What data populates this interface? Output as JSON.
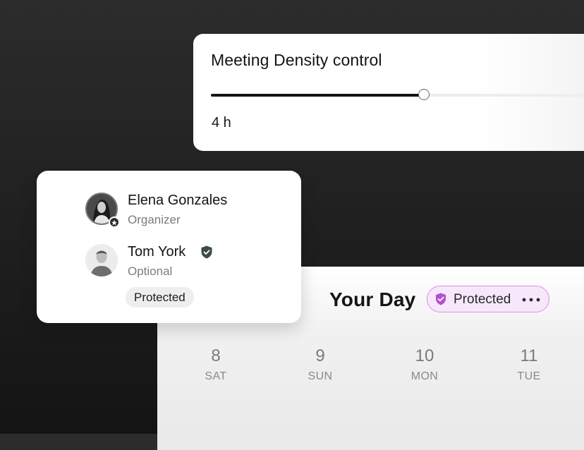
{
  "density": {
    "title": "Meeting Density control",
    "value_label": "4 h",
    "slider_level_percent": 54
  },
  "attendees": [
    {
      "name": "Elena Gonzales",
      "role": "Organizer",
      "badge_icon": "star-icon"
    },
    {
      "name": "Tom York",
      "role": "Optional",
      "badge_icon": "shield-check-icon"
    }
  ],
  "attendee_tag": "Protected",
  "calendar": {
    "title": "Your Day",
    "status_label": "Protected",
    "status_color": "#b24fd1",
    "days": [
      {
        "num": "8",
        "name": "SAT"
      },
      {
        "num": "9",
        "name": "SUN"
      },
      {
        "num": "10",
        "name": "MON"
      },
      {
        "num": "11",
        "name": "TUE"
      }
    ]
  }
}
